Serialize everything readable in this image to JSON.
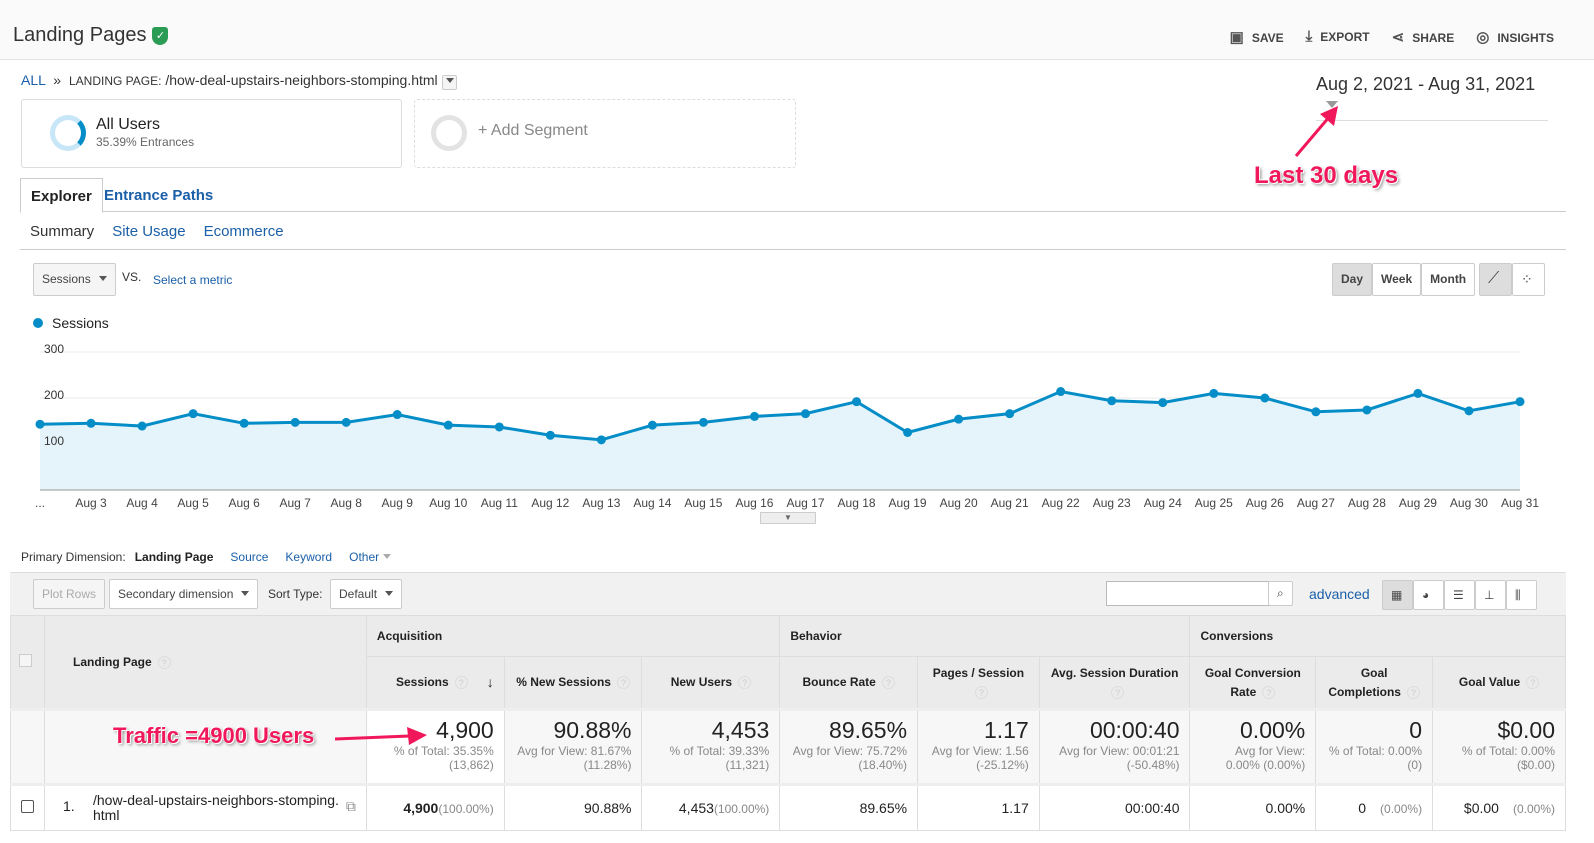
{
  "header": {
    "title": "Landing Pages",
    "actions": [
      {
        "label": "SAVE",
        "icon": "save-icon"
      },
      {
        "label": "EXPORT",
        "icon": "download-icon"
      },
      {
        "label": "SHARE",
        "icon": "share-icon"
      },
      {
        "label": "INSIGHTS",
        "icon": "insights-icon"
      }
    ]
  },
  "breadcrumb": {
    "all": "ALL",
    "sep": "»",
    "dim_label": "LANDING PAGE:",
    "value": "/how-deal-upstairs-neighbors-stomping.html"
  },
  "date_range": "Aug 2, 2021 - Aug 31, 2021",
  "segments": {
    "name": "All Users",
    "sub": "35.39% Entrances",
    "add": "+ Add Segment"
  },
  "tabs": [
    "Explorer",
    "Entrance Paths"
  ],
  "subtabs": [
    "Summary",
    "Site Usage",
    "Ecommerce"
  ],
  "chart_controls": {
    "metric": "Sessions",
    "vs": "VS.",
    "select_metric": "Select a metric",
    "periods": [
      "Day",
      "Week",
      "Month"
    ],
    "active_period": "Day"
  },
  "annotations": {
    "date": "Last 30 days",
    "traffic": "Traffic =4900 Users"
  },
  "chart_data": {
    "type": "area",
    "series": [
      {
        "name": "Sessions",
        "color": "#058dc7",
        "values": [
          143,
          145,
          139,
          166,
          145,
          147,
          147,
          164,
          141,
          137,
          119,
          109,
          141,
          147,
          160,
          166,
          192,
          125,
          154,
          166,
          214,
          194,
          190,
          210,
          200,
          170,
          174,
          210,
          172,
          192
        ]
      }
    ],
    "x": [
      "Aug 2",
      "Aug 3",
      "Aug 4",
      "Aug 5",
      "Aug 6",
      "Aug 7",
      "Aug 8",
      "Aug 9",
      "Aug 10",
      "Aug 11",
      "Aug 12",
      "Aug 13",
      "Aug 14",
      "Aug 15",
      "Aug 16",
      "Aug 17",
      "Aug 18",
      "Aug 19",
      "Aug 20",
      "Aug 21",
      "Aug 22",
      "Aug 23",
      "Aug 24",
      "Aug 25",
      "Aug 26",
      "Aug 27",
      "Aug 28",
      "Aug 29",
      "Aug 30",
      "Aug 31"
    ],
    "first_tick_label": "...",
    "yticks": [
      "300",
      "200",
      "100"
    ],
    "ylim": [
      0,
      300
    ],
    "grid": true,
    "legend": "top-left"
  },
  "dimensions": {
    "label": "Primary Dimension:",
    "active": "Landing Page",
    "others": [
      "Source",
      "Keyword",
      "Other"
    ]
  },
  "toolbar": {
    "plot_rows": "Plot Rows",
    "secondary": "Secondary dimension",
    "sort_label": "Sort Type:",
    "sort_value": "Default",
    "advanced": "advanced",
    "search_placeholder": ""
  },
  "table": {
    "groups": [
      "Acquisition",
      "Behavior",
      "Conversions"
    ],
    "dim_header": "Landing Page",
    "columns": [
      "Sessions",
      "% New Sessions",
      "New Users",
      "Bounce Rate",
      "Pages / Session",
      "Avg. Session Duration",
      "Goal Conversion Rate",
      "Goal Completions",
      "Goal Value"
    ],
    "totals": [
      {
        "v": "4,900",
        "a": "% of Total: 35.35%",
        "b": "(13,862)"
      },
      {
        "v": "90.88%",
        "a": "Avg for View: 81.67%",
        "b": "(11.28%)"
      },
      {
        "v": "4,453",
        "a": "% of Total: 39.33%",
        "b": "(11,321)"
      },
      {
        "v": "89.65%",
        "a": "Avg for View: 75.72%",
        "b": "(18.40%)"
      },
      {
        "v": "1.17",
        "a": "Avg for View: 1.56",
        "b": "(-25.12%)"
      },
      {
        "v": "00:00:40",
        "a": "Avg for View: 00:01:21",
        "b": "(-50.48%)"
      },
      {
        "v": "0.00%",
        "a": "Avg for View:",
        "b": "0.00% (0.00%)"
      },
      {
        "v": "0",
        "a": "% of Total: 0.00%",
        "b": "(0)"
      },
      {
        "v": "$0.00",
        "a": "% of Total: 0.00%",
        "b": "($0.00)"
      }
    ],
    "rows": [
      {
        "index": "1.",
        "page": "/how-deal-upstairs-neighbors-stomping.html",
        "cells": [
          {
            "v": "4,900",
            "p": "(100.00%)"
          },
          {
            "v": "90.88%",
            "p": ""
          },
          {
            "v": "4,453",
            "p": "(100.00%)"
          },
          {
            "v": "89.65%",
            "p": ""
          },
          {
            "v": "1.17",
            "p": ""
          },
          {
            "v": "00:00:40",
            "p": ""
          },
          {
            "v": "0.00%",
            "p": ""
          },
          {
            "v": "0",
            "p": "(0.00%)"
          },
          {
            "v": "$0.00",
            "p": "(0.00%)"
          }
        ]
      }
    ]
  }
}
